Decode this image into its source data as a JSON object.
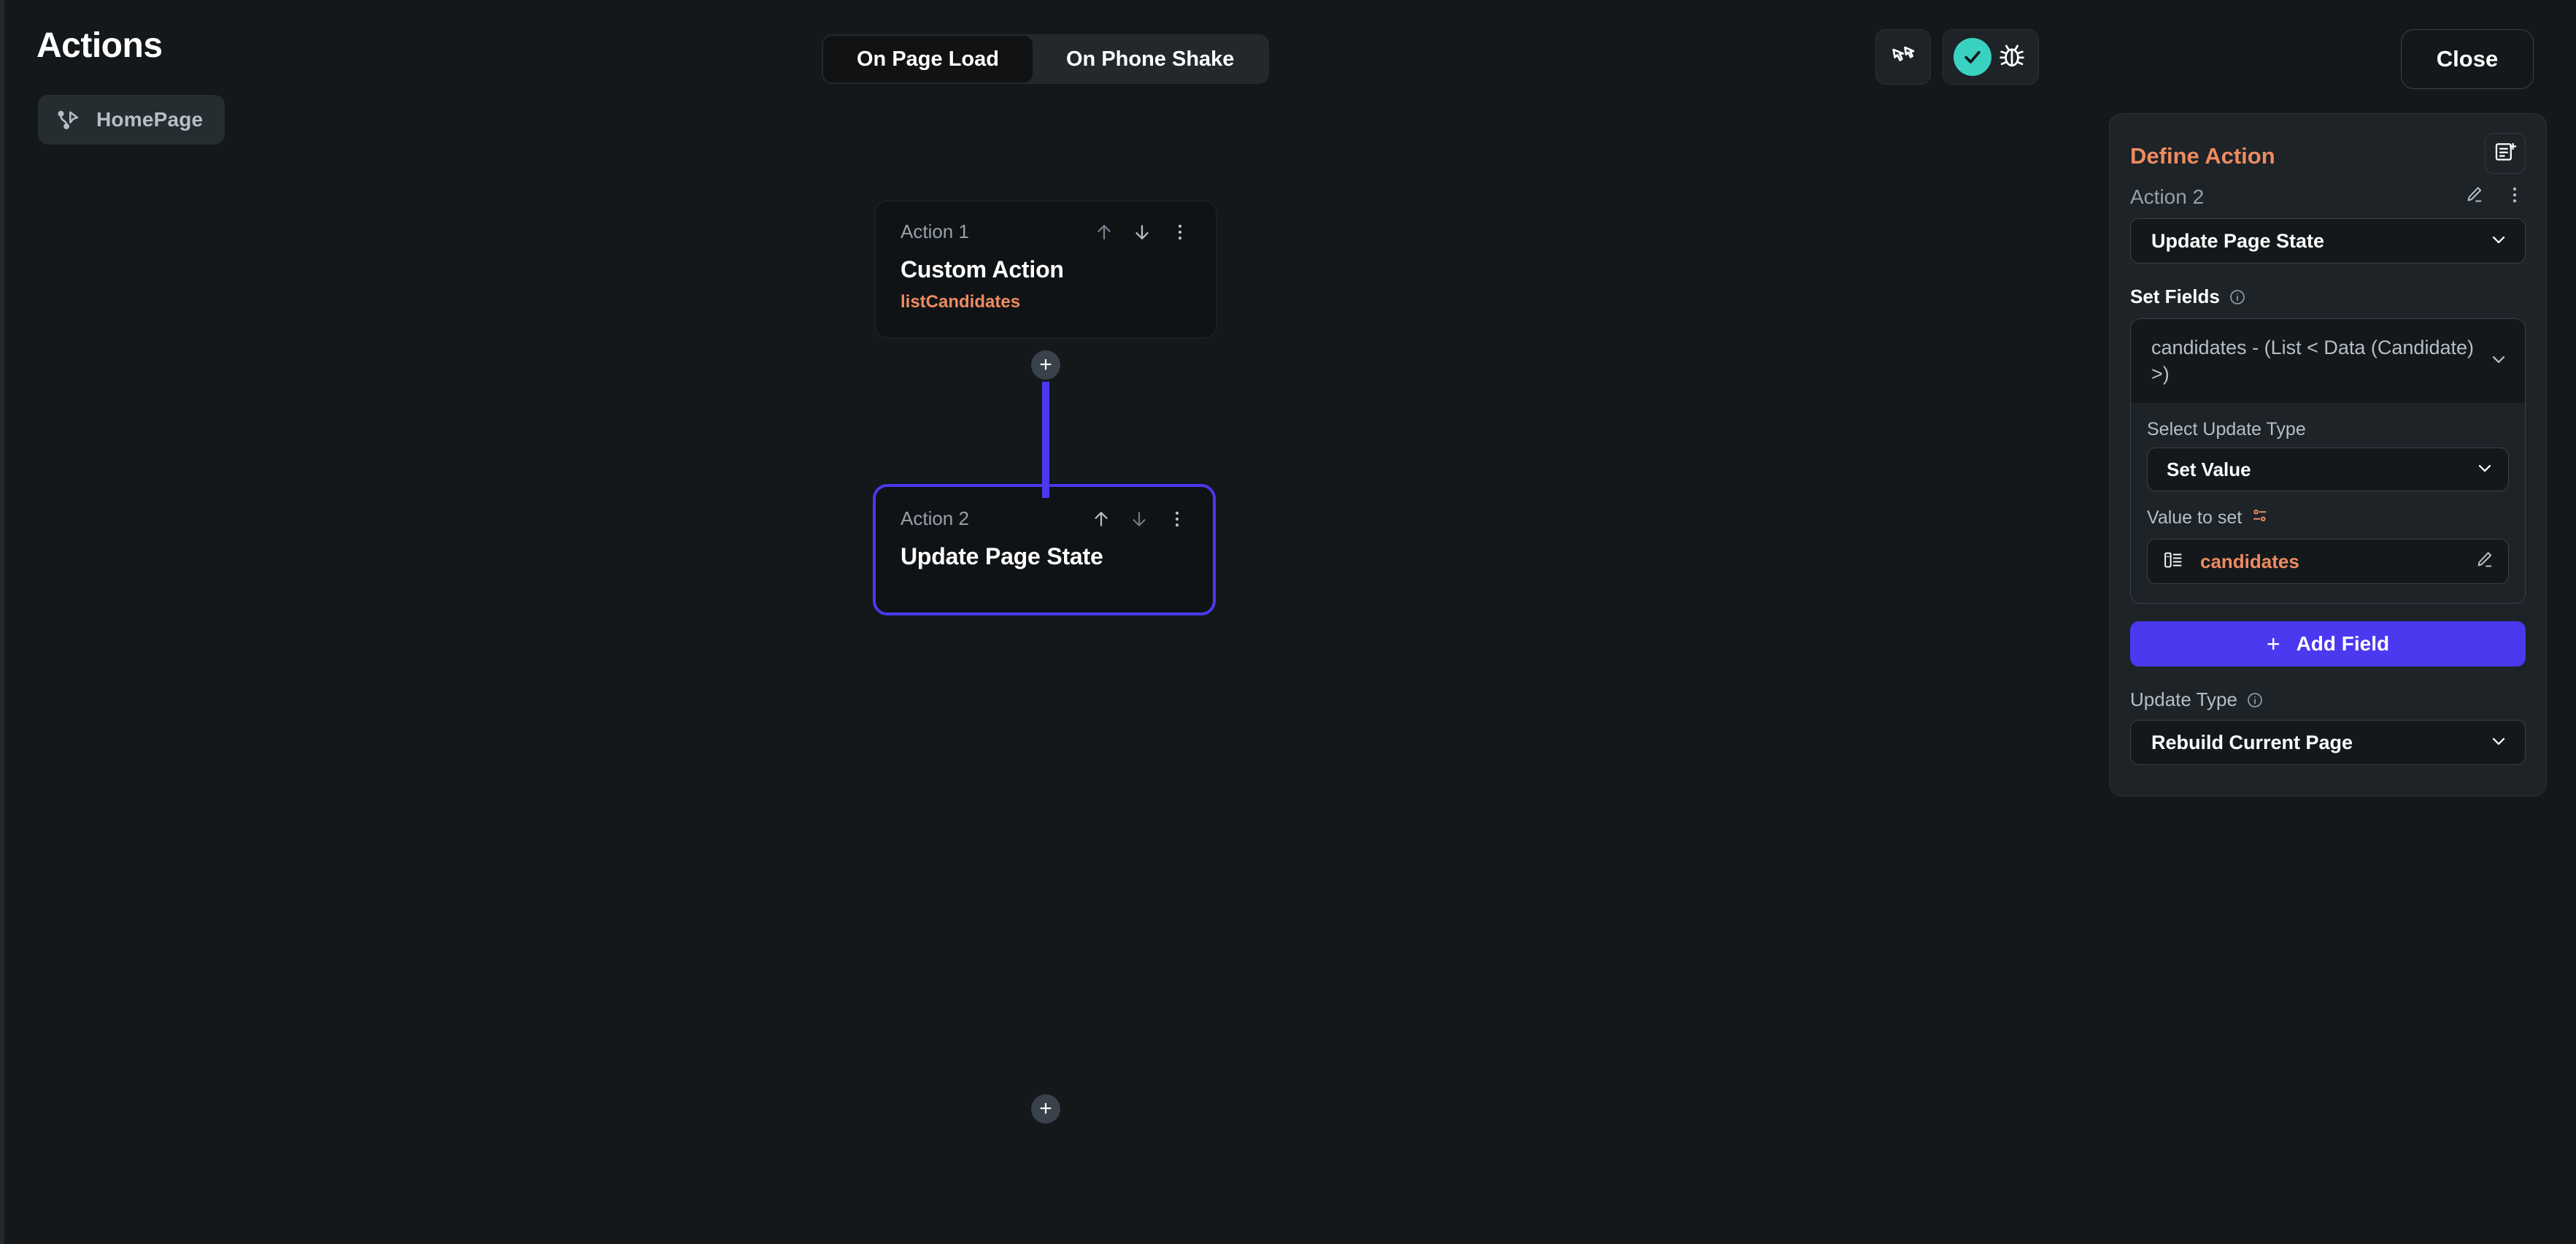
{
  "header": {
    "title": "Actions",
    "breadcrumb": {
      "label": "HomePage",
      "icon": "page-flow-icon"
    },
    "tabs": [
      {
        "label": "On Page Load",
        "active": true
      },
      {
        "label": "On Phone Shake",
        "active": false
      }
    ],
    "toolbar": {
      "cursor_button_icon": "multi-cursor-icon",
      "status_check_icon": "check-circle-icon",
      "debug_icon": "bug-icon",
      "status_color": "#39d2c0",
      "close_label": "Close"
    }
  },
  "canvas": {
    "nodes": [
      {
        "index_label": "Action 1",
        "title": "Custom Action",
        "subtitle": "listCandidates",
        "selected": false,
        "up_icon": "arrow-up-icon",
        "down_icon": "arrow-down-icon",
        "more_icon": "more-vertical-icon",
        "add_icon": "plus-icon"
      },
      {
        "index_label": "Action 2",
        "title": "Update Page State",
        "subtitle": "",
        "selected": true,
        "up_icon": "arrow-up-icon",
        "down_icon": "arrow-down-icon",
        "more_icon": "more-vertical-icon",
        "add_icon": "plus-icon"
      }
    ],
    "connector_color": "#4b39ef",
    "selected_border_color": "#4b39ef"
  },
  "panel": {
    "title": "Define Action",
    "title_color": "#ee8b60",
    "header_button_icon": "add-note-icon",
    "action_row": {
      "label": "Action 2",
      "edit_icon": "pencil-icon",
      "more_icon": "more-vertical-icon"
    },
    "action_type_select": {
      "value": "Update Page State",
      "chevron_icon": "chevron-down-icon"
    },
    "set_fields": {
      "label": "Set Fields",
      "info_icon": "info-icon",
      "field": {
        "name_value": "candidates - (List < Data (Candidate) >)",
        "chevron_icon": "chevron-down-icon",
        "update_type_label": "Select Update Type",
        "update_type_value": "Set Value",
        "value_label": "Value to set",
        "value_label_icon": "variable-icon",
        "value_icon": "data-type-icon",
        "value_text": "candidates",
        "value_edit_icon": "pencil-icon"
      }
    },
    "add_field": {
      "label": "Add Field",
      "icon": "plus-icon",
      "color": "#4b39ef"
    },
    "update_type": {
      "label": "Update Type",
      "info_icon": "info-icon",
      "value": "Rebuild Current Page",
      "chevron_icon": "chevron-down-icon"
    }
  }
}
